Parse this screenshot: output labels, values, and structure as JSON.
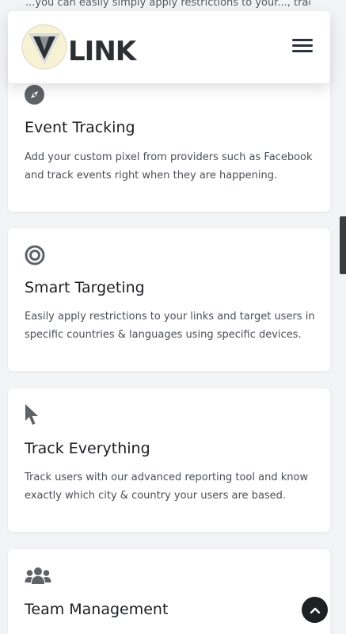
{
  "header": {
    "logo_text": "LINK",
    "menu_icon": "hamburger-menu-icon"
  },
  "peek_text": "...you can easily simply apply restrictions to your..., track..., Track for example",
  "features": [
    {
      "icon": "compass-icon",
      "title": "Event Tracking",
      "description": "Add your custom pixel from providers such as Facebook and track events right when they are happening."
    },
    {
      "icon": "target-icon",
      "title": "Smart Targeting",
      "description": "Easily apply restrictions to your links and target users in specific countries & languages using specific devices."
    },
    {
      "icon": "mouse-pointer-icon",
      "title": "Track Everything",
      "description": "Track users with our advanced reporting tool and know exactly which city & country your users are based."
    },
    {
      "icon": "users-icon",
      "title": "Team Management",
      "description": ""
    }
  ],
  "back_to_top_icon": "chevron-up-icon",
  "colors": {
    "page_bg": "#f3f4f6",
    "card_bg": "#ffffff",
    "icon_gray": "#5e6368",
    "button_dark": "#1e2022"
  }
}
